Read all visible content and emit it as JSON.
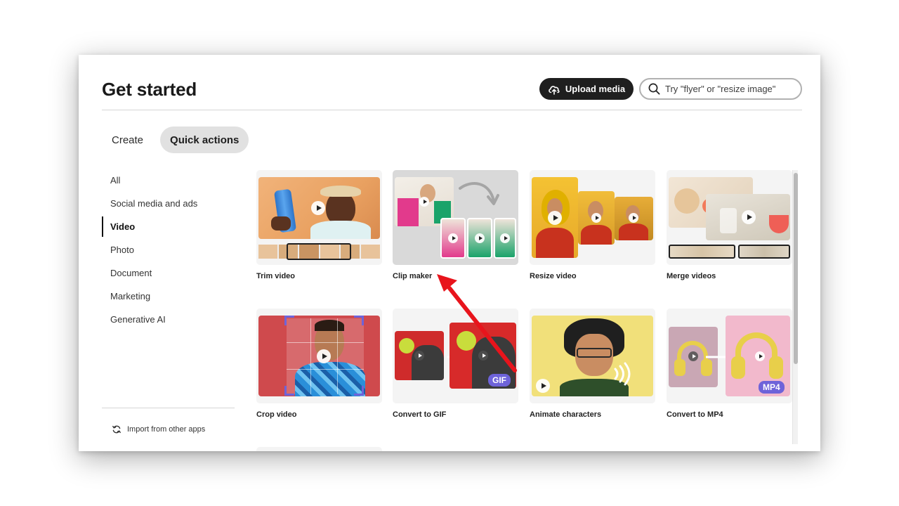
{
  "header": {
    "title": "Get started",
    "upload_label": "Upload media",
    "search_placeholder": "Try \"flyer\" or \"resize image\""
  },
  "tabs": [
    {
      "label": "Create",
      "active": false
    },
    {
      "label": "Quick actions",
      "active": true
    }
  ],
  "sidebar": {
    "items": [
      {
        "label": "All",
        "active": false
      },
      {
        "label": "Social media and ads",
        "active": false
      },
      {
        "label": "Video",
        "active": true
      },
      {
        "label": "Photo",
        "active": false
      },
      {
        "label": "Document",
        "active": false
      },
      {
        "label": "Marketing",
        "active": false
      },
      {
        "label": "Generative AI",
        "active": false
      }
    ],
    "import_label": "Import from other apps"
  },
  "cards": [
    {
      "label": "Trim video"
    },
    {
      "label": "Clip maker"
    },
    {
      "label": "Resize video"
    },
    {
      "label": "Merge videos"
    },
    {
      "label": "Crop video"
    },
    {
      "label": "Convert to GIF",
      "badge": "GIF"
    },
    {
      "label": "Animate characters"
    },
    {
      "label": "Convert to MP4",
      "badge": "MP4"
    }
  ],
  "colors": {
    "accent_badge": "#6e63d9",
    "annotation_arrow": "#e8141c",
    "upload_button": "#1f1f1f"
  }
}
